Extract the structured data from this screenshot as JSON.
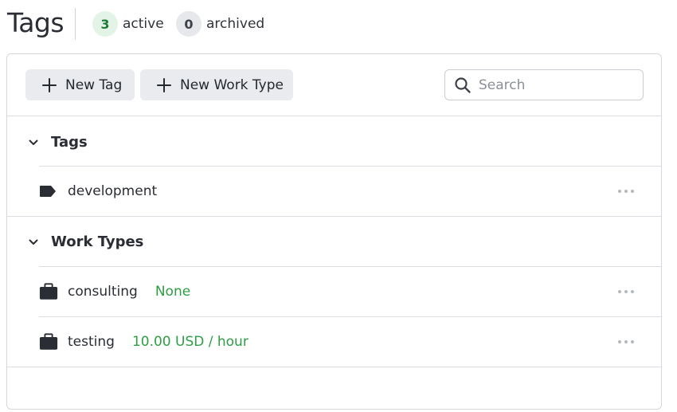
{
  "header": {
    "title": "Tags",
    "active_count": "3",
    "active_label": "active",
    "archived_count": "0",
    "archived_label": "archived"
  },
  "toolbar": {
    "new_tag_label": "New Tag",
    "new_work_type_label": "New Work Type",
    "search_placeholder": "Search"
  },
  "sections": [
    {
      "title": "Tags",
      "items": [
        {
          "label": "development",
          "icon": "tag-icon",
          "meta": ""
        }
      ]
    },
    {
      "title": "Work Types",
      "items": [
        {
          "label": "consulting",
          "icon": "briefcase-icon",
          "meta": "None"
        },
        {
          "label": "testing",
          "icon": "briefcase-icon",
          "meta": "10.00 USD / hour"
        }
      ]
    }
  ],
  "colors": {
    "accent_green": "#2e9e44",
    "active_badge_bg": "#e3f4e7",
    "archived_badge_bg": "#e6e8eb",
    "button_bg": "#e9ebee"
  }
}
